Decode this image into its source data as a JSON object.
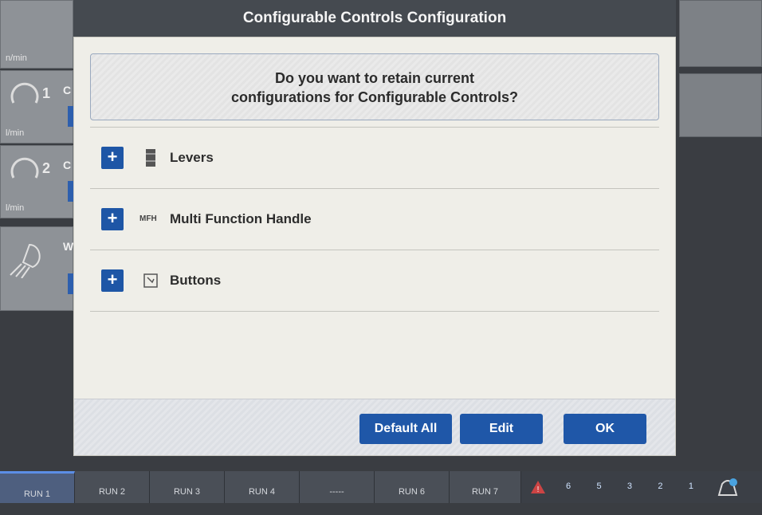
{
  "background": {
    "left_tiles": [
      {
        "unit": "n/min",
        "num": "",
        "letter": ""
      },
      {
        "unit": "l/min",
        "num": "1",
        "letter": "C"
      },
      {
        "unit": "l/min",
        "num": "2",
        "letter": "C"
      },
      {
        "unit": "",
        "num": "",
        "letter": "W"
      }
    ]
  },
  "dialog": {
    "title": "Configurable Controls Configuration",
    "question_line1": "Do you want to retain current",
    "question_line2": "configurations for Configurable Controls?",
    "rows": [
      {
        "label": "Levers",
        "icon": "lever-icon"
      },
      {
        "label": "Multi Function Handle",
        "icon": "mfh-icon",
        "icon_text": "MFH"
      },
      {
        "label": "Buttons",
        "icon": "buttons-icon"
      }
    ],
    "buttons": {
      "default_all": "Default All",
      "edit": "Edit",
      "ok": "OK"
    }
  },
  "tabbar": {
    "tabs": [
      "RUN 1",
      "RUN 2",
      "RUN 3",
      "RUN 4",
      "-----",
      "RUN 6",
      "RUN 7"
    ],
    "active_index": 0,
    "status_labels": [
      "6",
      "5",
      "3",
      "2",
      "1"
    ]
  },
  "colors": {
    "accent_blue": "#1f57a8",
    "dialog_bg": "#efeee8"
  }
}
